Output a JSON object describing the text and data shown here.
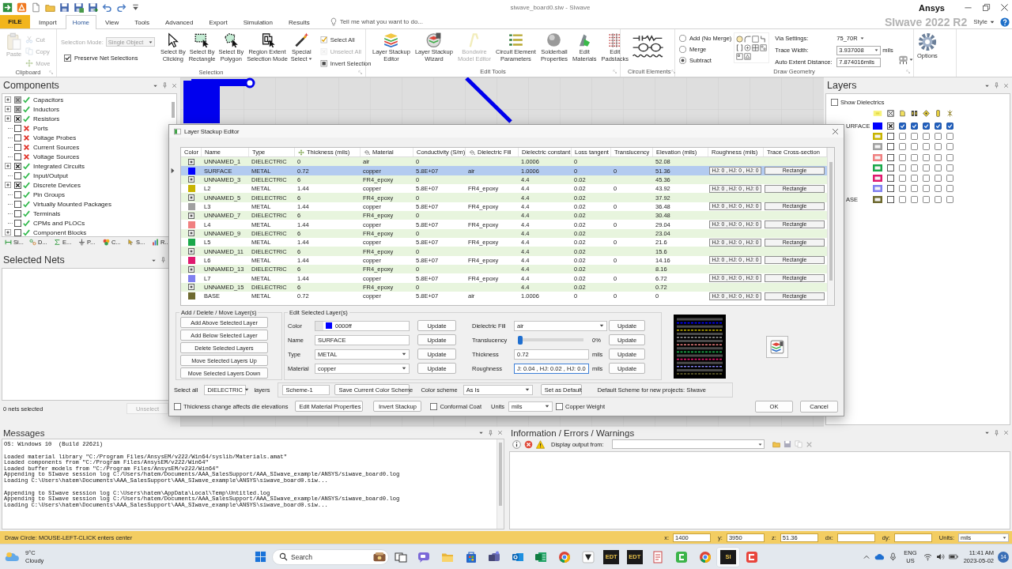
{
  "window": {
    "title": "siwave_board0.siw - SIwave",
    "brand": "Ansys",
    "product": "SIwave 2022 R2",
    "style_menu": "Style"
  },
  "ribbon_tabs": [
    {
      "label": "FILE",
      "kind": "file",
      "selected": false
    },
    {
      "label": "Import",
      "kind": "tab",
      "selected": false
    },
    {
      "label": "Home",
      "kind": "tab",
      "selected": true
    },
    {
      "label": "View",
      "kind": "tab",
      "selected": false
    },
    {
      "label": "Tools",
      "kind": "tab",
      "selected": false
    },
    {
      "label": "Advanced",
      "kind": "tab",
      "selected": false
    },
    {
      "label": "Export",
      "kind": "tab",
      "selected": false
    },
    {
      "label": "Simulation",
      "kind": "tab",
      "selected": false
    },
    {
      "label": "Results",
      "kind": "tab",
      "selected": false
    }
  ],
  "tell_me": {
    "placeholder": "Tell me what you want to do..."
  },
  "clipboard": {
    "title": "Clipboard",
    "paste": {
      "label": "Paste",
      "disabled": true
    },
    "actions": [
      {
        "label": "Cut",
        "disabled": true
      },
      {
        "label": "Copy",
        "disabled": true
      },
      {
        "label": "Move",
        "disabled": true
      }
    ]
  },
  "selection": {
    "title": "Selection",
    "mode_label": "Selection Mode:",
    "mode": {
      "value": "Single Object",
      "disabled": true
    },
    "preserve": {
      "label": "Preserve Net Selections",
      "checked": true
    },
    "tools": [
      {
        "label": "Select By\nClicking",
        "kind": "button"
      },
      {
        "label": "Select By\nRectangle",
        "kind": "button"
      },
      {
        "label": "Select By\nPolygon",
        "kind": "button"
      },
      {
        "label": "Region Extent\nSelection Mode",
        "kind": "button"
      },
      {
        "label": "Special\nSelect",
        "kind": "menu"
      }
    ],
    "actions": [
      {
        "label": "Select All",
        "disabled": false
      },
      {
        "label": "Unselect All",
        "disabled": true
      },
      {
        "label": "Invert Selection",
        "disabled": false
      }
    ]
  },
  "edit_tools": {
    "title": "Edit Tools",
    "tools": [
      {
        "label": "Layer Stackup\nEditor",
        "disabled": false
      },
      {
        "label": "Layer Stackup\nWizard",
        "disabled": false
      },
      {
        "label": "Bondwire\nModel Editor",
        "disabled": true
      },
      {
        "label": "Circuit Element\nParameters",
        "disabled": false
      },
      {
        "label": "Solderball\nProperties",
        "disabled": false
      },
      {
        "label": "Edit\nMaterials",
        "disabled": false
      },
      {
        "label": "Edit\nPadstacks",
        "disabled": false
      }
    ]
  },
  "circuit_elements": {
    "title": "Circuit Elements"
  },
  "draw_geometry": {
    "title": "Draw Geometry",
    "modes": [
      {
        "label": "Add (No Merge)",
        "selected": false
      },
      {
        "label": "Merge",
        "selected": false
      },
      {
        "label": "Subtract",
        "selected": true
      }
    ],
    "fields": [
      {
        "label": "Via Settings:",
        "kind": "menu",
        "value": "75_70R"
      },
      {
        "label": "Trace Width:",
        "kind": "combo",
        "value": "3.937008",
        "unit": "mils"
      },
      {
        "label": "Auto Extent Distance:",
        "kind": "text",
        "value": "7.874016mils"
      }
    ]
  },
  "options": {
    "label": "Options"
  },
  "components": {
    "title": "Components",
    "items": [
      {
        "label": "Capacitors",
        "expander": true,
        "checked": true,
        "partial": true,
        "ok": true
      },
      {
        "label": "Inductors",
        "expander": true,
        "checked": true,
        "partial": true,
        "ok": true
      },
      {
        "label": "Resistors",
        "expander": true,
        "checked": true,
        "partial": false,
        "ok": true
      },
      {
        "label": "Ports",
        "expander": false,
        "checked": false,
        "partial": false,
        "ok": false
      },
      {
        "label": "Voltage Probes",
        "expander": false,
        "checked": false,
        "partial": false,
        "ok": false
      },
      {
        "label": "Current Sources",
        "expander": false,
        "checked": false,
        "partial": false,
        "ok": false
      },
      {
        "label": "Voltage Sources",
        "expander": false,
        "checked": false,
        "partial": false,
        "ok": false
      },
      {
        "label": "Integrated Circuits",
        "expander": true,
        "checked": true,
        "partial": false,
        "ok": true
      },
      {
        "label": "Input/Output",
        "expander": false,
        "checked": false,
        "partial": false,
        "ok": true
      },
      {
        "label": "Discrete Devices",
        "expander": true,
        "checked": true,
        "partial": false,
        "ok": true
      },
      {
        "label": "Pin Groups",
        "expander": false,
        "checked": false,
        "partial": false,
        "ok": true
      },
      {
        "label": "Virtually Mounted Packages",
        "expander": false,
        "checked": false,
        "partial": false,
        "ok": true
      },
      {
        "label": "Terminals",
        "expander": false,
        "checked": false,
        "partial": false,
        "ok": true
      },
      {
        "label": "CPMs and PLOCs",
        "expander": false,
        "checked": false,
        "partial": false,
        "ok": true
      },
      {
        "label": "Component Blocks",
        "expander": true,
        "checked": false,
        "partial": false,
        "ok": true
      }
    ],
    "tabs": [
      {
        "label": "Si...",
        "selected": false
      },
      {
        "label": "D...",
        "selected": false
      },
      {
        "label": "E...",
        "selected": false
      },
      {
        "label": "P...",
        "selected": false
      },
      {
        "label": "C...",
        "selected": false
      },
      {
        "label": "S...",
        "selected": false
      },
      {
        "label": "R...",
        "selected": false
      }
    ]
  },
  "selected_nets": {
    "title": "Selected Nets",
    "status": "0 nets selected",
    "unselect": {
      "label": "Unselect",
      "disabled": true
    }
  },
  "layers": {
    "title": "Layers",
    "show_dielectrics": {
      "label": "Show Dielectrics",
      "checked": false
    },
    "rows": [
      {
        "name": "URFACE",
        "color": "#0000ff",
        "active": true,
        "shown": true,
        "on": true
      },
      {
        "color": "#c8b400",
        "active": false,
        "shown": false,
        "on": false
      },
      {
        "color": "#a0a0a0",
        "active": false,
        "shown": false,
        "on": false
      },
      {
        "color": "#f08080",
        "active": false,
        "shown": false,
        "on": false
      },
      {
        "color": "#1aa84a",
        "active": false,
        "shown": false,
        "on": false
      },
      {
        "color": "#e0196e",
        "active": false,
        "shown": false,
        "on": false
      },
      {
        "color": "#8080f0",
        "active": false,
        "shown": false,
        "on": false
      },
      {
        "name": "ASE",
        "color": "#6e6a30",
        "active": false,
        "shown": false,
        "on": false
      }
    ]
  },
  "stackup_editor": {
    "title": "Layer Stackup Editor",
    "columns": [
      {
        "label": "Color",
        "kind": "plain"
      },
      {
        "label": "Name",
        "kind": "plain"
      },
      {
        "label": "Type",
        "kind": "plain"
      },
      {
        "label": "Thickness (mils)",
        "kind": "resize"
      },
      {
        "label": "Material",
        "kind": "material"
      },
      {
        "label": "Conductivity (S/m)",
        "kind": "plain"
      },
      {
        "label": "Dielectric Fill",
        "kind": "material"
      },
      {
        "label": "Dielectric constant",
        "kind": "plain"
      },
      {
        "label": "Loss tangent",
        "kind": "plain"
      },
      {
        "label": "Translucency",
        "kind": "plain"
      },
      {
        "label": "Elevation (mils)",
        "kind": "plain"
      },
      {
        "label": "Roughness (mils)",
        "kind": "plain"
      },
      {
        "label": "Trace Cross-section",
        "kind": "plain"
      }
    ],
    "rows": [
      {
        "kind": "dielectric",
        "selected": false,
        "name": "UNNAMED_1",
        "type": "DIELECTRIC",
        "thickness": "0",
        "material": "air",
        "conductivity": "0",
        "dk": "1.0006",
        "loss": "0",
        "elevation": "52.08"
      },
      {
        "kind": "metal",
        "selected": true,
        "color": "#0000ff",
        "name": "SURFACE",
        "type": "METAL",
        "thickness": "0.72",
        "material": "copper",
        "conductivity": "5.8E+07",
        "fill": "air",
        "dk": "1.0006",
        "loss": "0",
        "translucency": "0",
        "elevation": "51.36",
        "roughness": "HJ: 0 , HJ: 0 , HJ: 0",
        "cross_section": "Rectangle"
      },
      {
        "kind": "dielectric",
        "selected": false,
        "name": "UNNAMED_3",
        "type": "DIELECTRIC",
        "thickness": "6",
        "material": "FR4_epoxy",
        "conductivity": "0",
        "dk": "4.4",
        "loss": "0.02",
        "elevation": "45.36"
      },
      {
        "kind": "metal",
        "selected": false,
        "color": "#c8b400",
        "name": "L2",
        "type": "METAL",
        "thickness": "1.44",
        "material": "copper",
        "conductivity": "5.8E+07",
        "fill": "FR4_epoxy",
        "dk": "4.4",
        "loss": "0.02",
        "translucency": "0",
        "elevation": "43.92",
        "roughness": "HJ: 0 , HJ: 0 , HJ: 0",
        "cross_section": "Rectangle"
      },
      {
        "kind": "dielectric",
        "selected": false,
        "name": "UNNAMED_5",
        "type": "DIELECTRIC",
        "thickness": "6",
        "material": "FR4_epoxy",
        "conductivity": "0",
        "dk": "4.4",
        "loss": "0.02",
        "elevation": "37.92"
      },
      {
        "kind": "metal",
        "selected": false,
        "color": "#a0a0a0",
        "name": "L3",
        "type": "METAL",
        "thickness": "1.44",
        "material": "copper",
        "conductivity": "5.8E+07",
        "fill": "FR4_epoxy",
        "dk": "4.4",
        "loss": "0.02",
        "translucency": "0",
        "elevation": "36.48",
        "roughness": "HJ: 0 , HJ: 0 , HJ: 0",
        "cross_section": "Rectangle"
      },
      {
        "kind": "dielectric",
        "selected": false,
        "name": "UNNAMED_7",
        "type": "DIELECTRIC",
        "thickness": "6",
        "material": "FR4_epoxy",
        "conductivity": "0",
        "dk": "4.4",
        "loss": "0.02",
        "elevation": "30.48"
      },
      {
        "kind": "metal",
        "selected": false,
        "color": "#f08080",
        "name": "L4",
        "type": "METAL",
        "thickness": "1.44",
        "material": "copper",
        "conductivity": "5.8E+07",
        "fill": "FR4_epoxy",
        "dk": "4.4",
        "loss": "0.02",
        "translucency": "0",
        "elevation": "29.04",
        "roughness": "HJ: 0 , HJ: 0 , HJ: 0",
        "cross_section": "Rectangle"
      },
      {
        "kind": "dielectric",
        "selected": false,
        "name": "UNNAMED_9",
        "type": "DIELECTRIC",
        "thickness": "6",
        "material": "FR4_epoxy",
        "conductivity": "0",
        "dk": "4.4",
        "loss": "0.02",
        "elevation": "23.04"
      },
      {
        "kind": "metal",
        "selected": false,
        "color": "#1aa84a",
        "name": "L5",
        "type": "METAL",
        "thickness": "1.44",
        "material": "copper",
        "conductivity": "5.8E+07",
        "fill": "FR4_epoxy",
        "dk": "4.4",
        "loss": "0.02",
        "translucency": "0",
        "elevation": "21.6",
        "roughness": "HJ: 0 , HJ: 0 , HJ: 0",
        "cross_section": "Rectangle"
      },
      {
        "kind": "dielectric",
        "selected": false,
        "name": "UNNAMED_11",
        "type": "DIELECTRIC",
        "thickness": "6",
        "material": "FR4_epoxy",
        "conductivity": "0",
        "dk": "4.4",
        "loss": "0.02",
        "elevation": "15.6"
      },
      {
        "kind": "metal",
        "selected": false,
        "color": "#e0196e",
        "name": "L6",
        "type": "METAL",
        "thickness": "1.44",
        "material": "copper",
        "conductivity": "5.8E+07",
        "fill": "FR4_epoxy",
        "dk": "4.4",
        "loss": "0.02",
        "translucency": "0",
        "elevation": "14.16",
        "roughness": "HJ: 0 , HJ: 0 , HJ: 0",
        "cross_section": "Rectangle"
      },
      {
        "kind": "dielectric",
        "selected": false,
        "name": "UNNAMED_13",
        "type": "DIELECTRIC",
        "thickness": "6",
        "material": "FR4_epoxy",
        "conductivity": "0",
        "dk": "4.4",
        "loss": "0.02",
        "elevation": "8.16"
      },
      {
        "kind": "metal",
        "selected": false,
        "color": "#8080f0",
        "name": "L7",
        "type": "METAL",
        "thickness": "1.44",
        "material": "copper",
        "conductivity": "5.8E+07",
        "fill": "FR4_epoxy",
        "dk": "4.4",
        "loss": "0.02",
        "translucency": "0",
        "elevation": "6.72",
        "roughness": "HJ: 0 , HJ: 0 , HJ: 0",
        "cross_section": "Rectangle"
      },
      {
        "kind": "dielectric",
        "selected": false,
        "name": "UNNAMED_15",
        "type": "DIELECTRIC",
        "thickness": "6",
        "material": "FR4_epoxy",
        "conductivity": "0",
        "dk": "4.4",
        "loss": "0.02",
        "elevation": "0.72"
      },
      {
        "kind": "metal",
        "selected": false,
        "color": "#6e6a30",
        "name": "BASE",
        "type": "METAL",
        "thickness": "0.72",
        "material": "copper",
        "conductivity": "5.8E+07",
        "fill": "air",
        "dk": "1.0006",
        "loss": "0",
        "translucency": "0",
        "elevation": "0",
        "roughness": "HJ: 0 , HJ: 0 , HJ: 0",
        "cross_section": "Rectangle"
      }
    ],
    "layer_ops": {
      "title": "Add / Delete / Move Layer(s)",
      "buttons": [
        "Add Above Selected Layer",
        "Add Below Selected Layer",
        "Delete Selected Layers",
        "Move Selected Layers Up",
        "Move Selected Layers Down"
      ]
    },
    "edit": {
      "title": "Edit Selected Layer(s)",
      "fields": [
        {
          "label": "Color",
          "kind": "color",
          "value": "0000ff",
          "color": "#0000ff",
          "button": "Update"
        },
        {
          "label": "Dielectric Fill",
          "kind": "select",
          "value": "air",
          "button": "Update"
        },
        {
          "label": "Name",
          "kind": "text",
          "value": "SURFACE",
          "focused": false,
          "button": "Update"
        },
        {
          "label": "Translucency",
          "kind": "slider",
          "level": 0,
          "reading": "0%",
          "button": "Update"
        },
        {
          "label": "Type",
          "kind": "select",
          "value": "METAL",
          "button": "Update"
        },
        {
          "label": "Thickness",
          "kind": "text",
          "value": "0.72",
          "unit": "mils",
          "focused": false,
          "button": "Update"
        },
        {
          "label": "Material",
          "kind": "select",
          "value": "copper",
          "button": "Update"
        },
        {
          "label": "Roughness",
          "kind": "text",
          "value": "J: 0.04 , HJ: 0.02 , HJ: 0.0",
          "unit": "mils",
          "focused": true,
          "button": "Update"
        }
      ]
    },
    "select_all": {
      "label": "Select all",
      "value": "DIELECTRIC",
      "suffix": "layers"
    },
    "scheme": {
      "name": "Scheme-1",
      "save": "Save Current Color Scheme",
      "label": "Color scheme",
      "value": "As Is",
      "set_default": "Set as Default",
      "note": "Default Scheme for new projects: SIwave"
    },
    "footer": {
      "thickness_change": {
        "label": "Thickness change affects die elevations",
        "checked": false
      },
      "edit_materials": "Edit Material Properties",
      "invert": "Invert Stackup",
      "conformal": {
        "label": "Conformal Coat",
        "checked": false
      },
      "units": {
        "label": "Units",
        "value": "mils"
      },
      "copper_weight": {
        "label": "Copper Weight",
        "checked": false
      },
      "ok": "OK",
      "cancel": "Cancel"
    }
  },
  "messages": {
    "title": "Messages",
    "blocks": [
      {
        "lines": [
          "OS: Windows 10  (Build 22621)"
        ]
      },
      {
        "lines": [
          "Loaded material library \"C:/Program Files/AnsysEM/v222/Win64/syslib/Materials.amat\"",
          "Loaded components from \"C:/Program Files/AnsysEM/v222/Win64\"",
          "Loaded buffer models from \"C:/Program Files/AnsysEM/v222/Win64\"",
          "Appending to SIwave session log C:/Users/hatem/Documents/AAA_SalesSupport/AAA_SIwave_example/ANSYS/siwave_board0.log",
          "Loading C:\\Users\\hatem\\Documents\\AAA_SalesSupport\\AAA_SIwave_example\\ANSYS\\siwave_board0.siw..."
        ]
      },
      {
        "lines": [
          "Appending to SIwave session log C:\\Users\\hatem\\AppData\\Local\\Temp\\Untitled.log",
          "Appending to SIwave session log C:/Users/hatem/Documents/AAA_SalesSupport/AAA_SIwave_example/ANSYS/siwave_board0.log",
          "Loading C:\\Users\\hatem\\Documents\\AAA_SalesSupport\\AAA_SIwave_example\\ANSYS\\siwave_board0.siw..."
        ]
      }
    ]
  },
  "info": {
    "title": "Information / Errors / Warnings",
    "display_label": "Display output from:"
  },
  "status_bar": {
    "message": "Draw Circle: MOUSE-LEFT-CLICK enters center",
    "coords": [
      {
        "label": "x:",
        "value": "1400"
      },
      {
        "label": "y:",
        "value": "3950"
      },
      {
        "label": "z:",
        "value": "51.36"
      },
      {
        "label": "dx:"
      },
      {
        "label": "dy:"
      }
    ],
    "units": {
      "label": "Units:",
      "value": "mils"
    }
  },
  "taskbar": {
    "weather": {
      "temperature": "9°C",
      "condition": "Cloudy"
    },
    "search": {
      "placeholder": "Search"
    },
    "apps": [
      {
        "active": false
      },
      {
        "active": false
      },
      {
        "active": false
      },
      {
        "active": false
      },
      {
        "active": false
      },
      {
        "active": false
      },
      {
        "active": false
      },
      {
        "active": false
      },
      {
        "active": false
      },
      {
        "label": "EDT",
        "active": false
      },
      {
        "label": "EDT",
        "active": false
      },
      {
        "active": false
      },
      {
        "active": false
      },
      {
        "active": false
      },
      {
        "label": "SI",
        "active": true
      },
      {
        "active": false
      }
    ],
    "language": "ENG",
    "region": "US",
    "time": "11:41 AM",
    "date": "2023-05-02",
    "notifications": "14"
  }
}
